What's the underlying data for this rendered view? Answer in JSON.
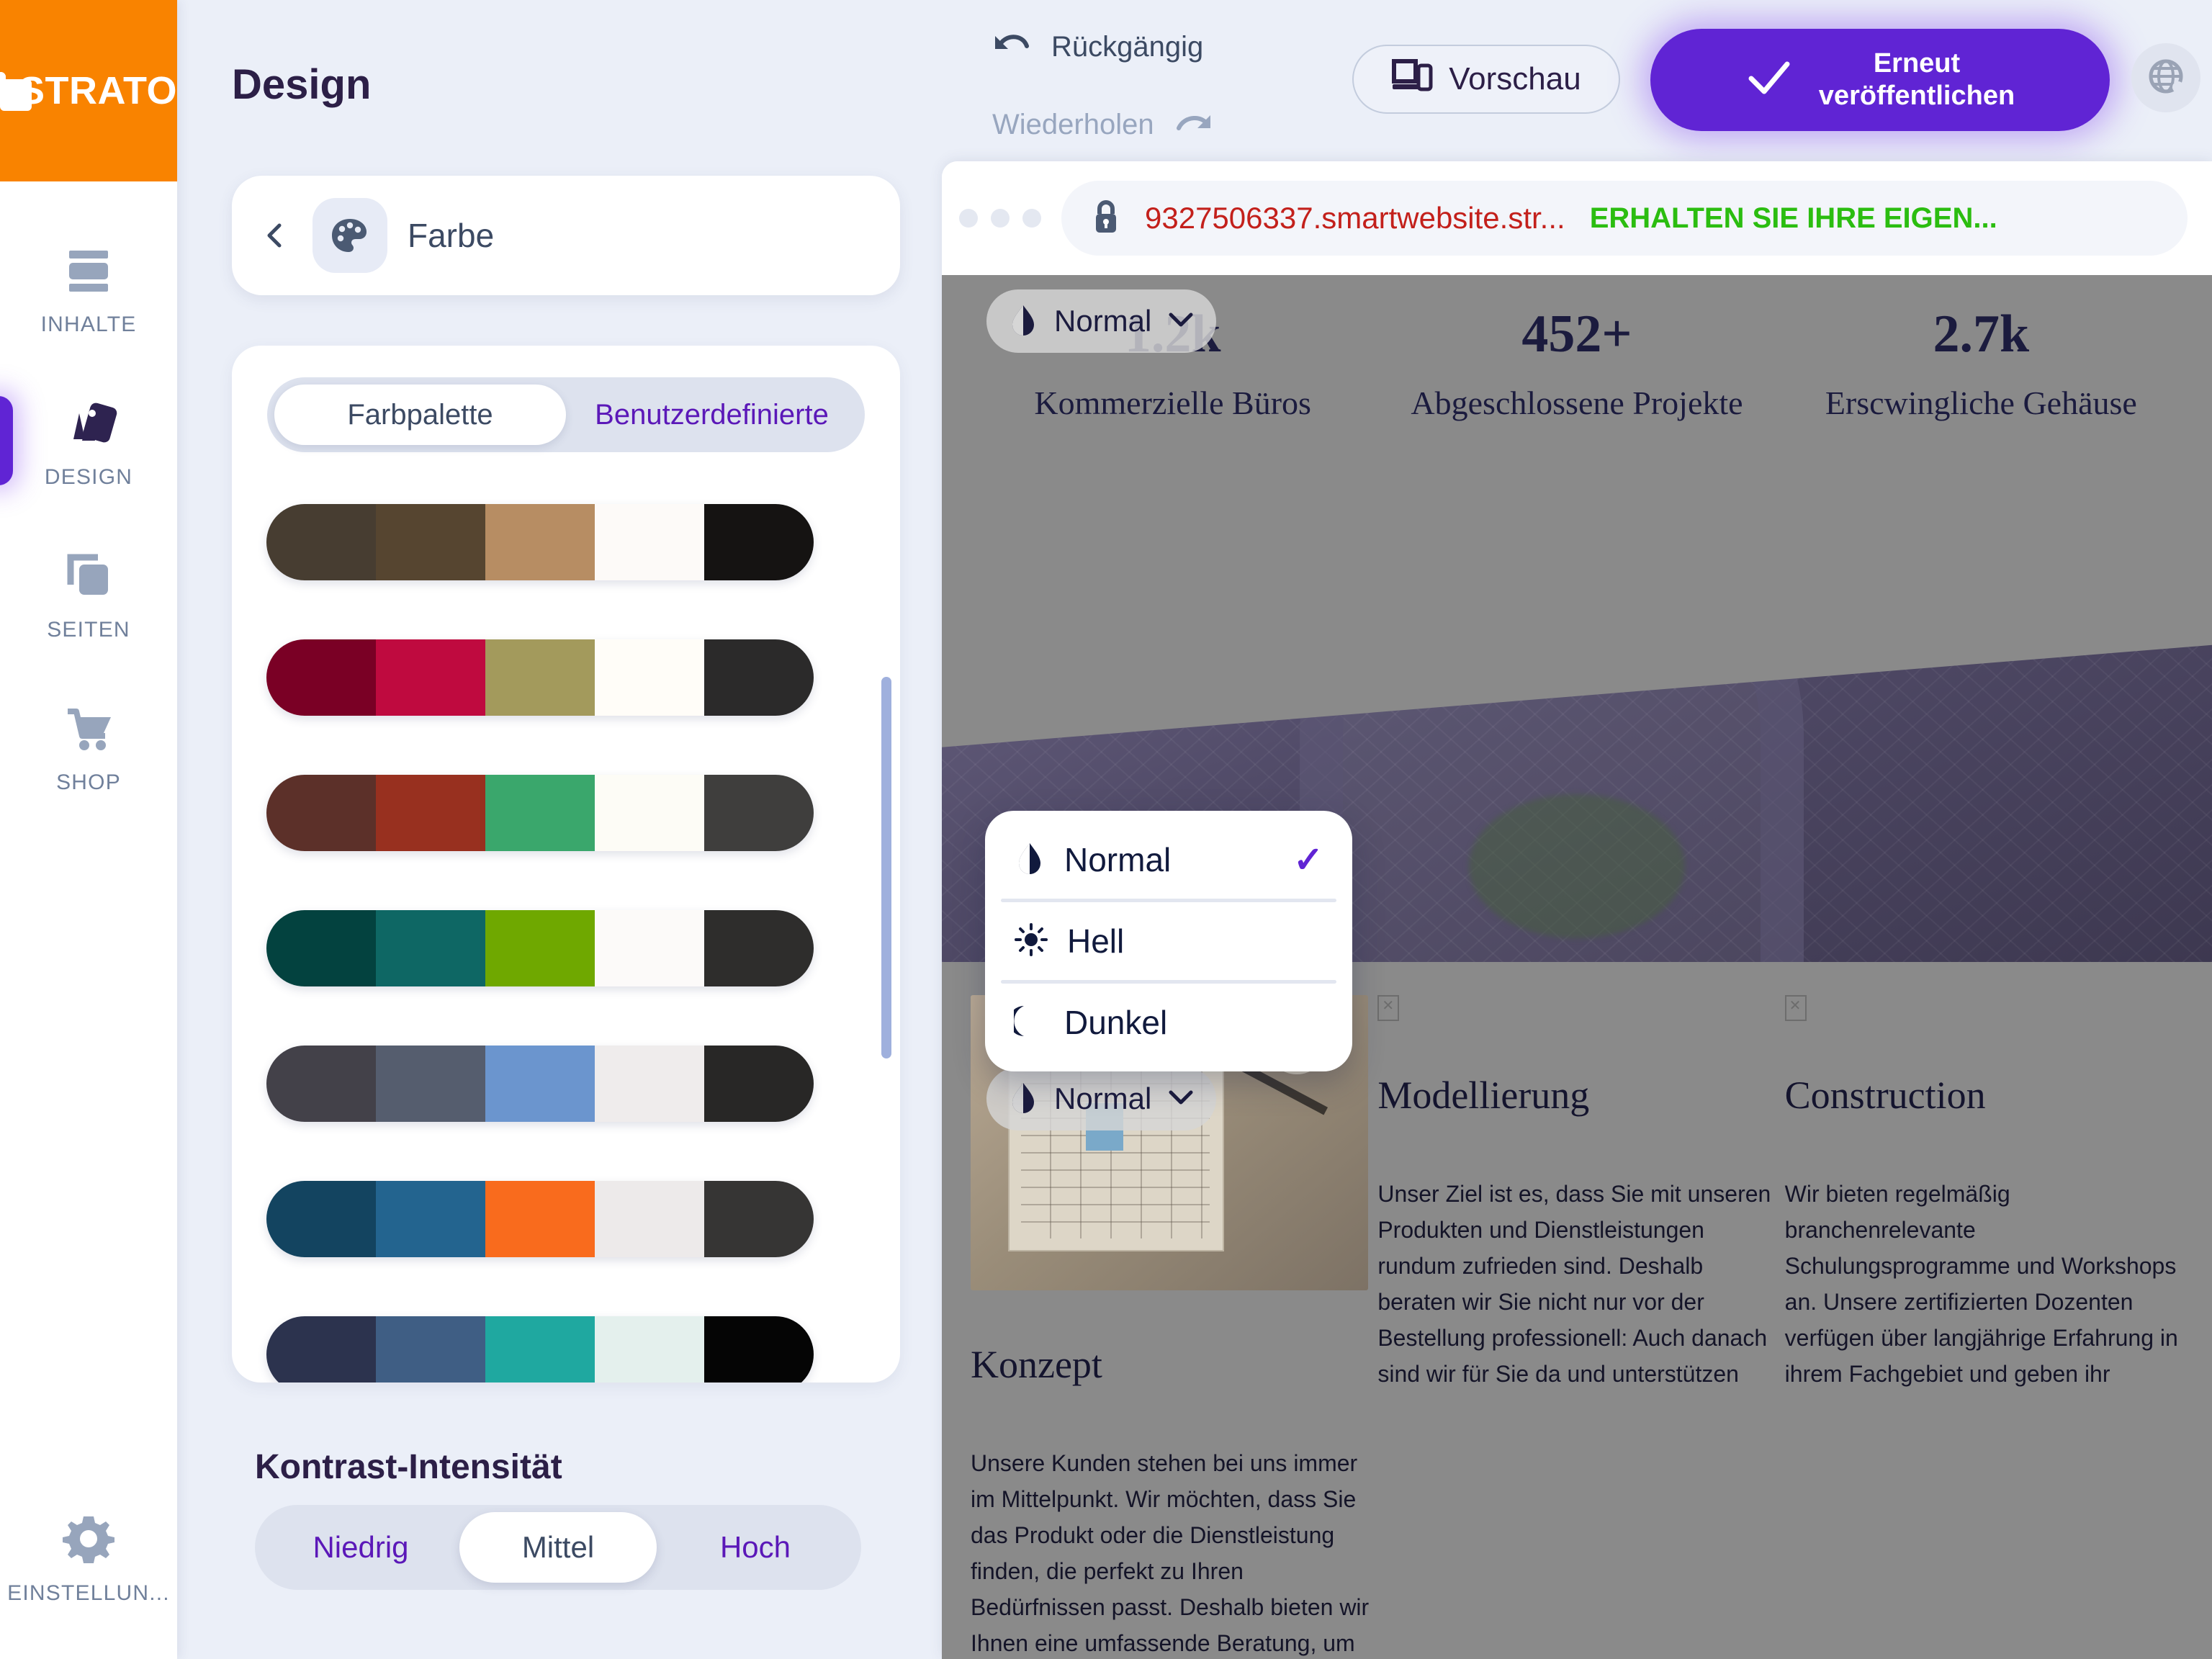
{
  "brand": {
    "name": "STRATO"
  },
  "rail": {
    "items": [
      {
        "label": "INHALTE",
        "icon": "content-layout-icon",
        "active": false
      },
      {
        "label": "DESIGN",
        "icon": "design-swatches-icon",
        "active": true
      },
      {
        "label": "SEITEN",
        "icon": "pages-icon",
        "active": false
      },
      {
        "label": "SHOP",
        "icon": "cart-icon",
        "active": false
      }
    ],
    "bottom": {
      "label": "EINSTELLUN...",
      "icon": "gear-icon"
    }
  },
  "panel": {
    "title": "Design",
    "farbe": {
      "label": "Farbe",
      "back_icon": "chevron-left-icon",
      "icon": "palette-icon"
    },
    "tabs": [
      {
        "label": "Farbpalette",
        "active": true
      },
      {
        "label": "Benutzerdefinierte",
        "active": false
      }
    ],
    "palettes": [
      {
        "colors": [
          "#473D31",
          "#564530",
          "#B78D63",
          "#FDFAF8",
          "#151312"
        ]
      },
      {
        "colors": [
          "#7A0025",
          "#BF0A3F",
          "#A39A5C",
          "#FFFDF8",
          "#2B2A2A"
        ]
      },
      {
        "colors": [
          "#5C3029",
          "#98301F",
          "#3AA76C",
          "#FDFCF6",
          "#3F3E3D"
        ]
      },
      {
        "colors": [
          "#03423F",
          "#0E6764",
          "#6FA800",
          "#FCFAF9",
          "#2E2D2C"
        ]
      },
      {
        "colors": [
          "#434149",
          "#555D6E",
          "#6B95CE",
          "#EFECEC",
          "#282726"
        ]
      },
      {
        "colors": [
          "#134460",
          "#23648F",
          "#F96B1D",
          "#EDEAEA",
          "#363534"
        ]
      },
      {
        "colors": [
          "#2C334E",
          "#3F5E84",
          "#1FA8A0",
          "#E4F0ED",
          "#050505"
        ]
      }
    ],
    "kontrast": {
      "title": "Kontrast-Intensität",
      "options": [
        {
          "label": "Niedrig",
          "active": false
        },
        {
          "label": "Mittel",
          "active": true
        },
        {
          "label": "Hoch",
          "active": false
        }
      ]
    }
  },
  "toolbar": {
    "undo": {
      "label": "Rückgängig",
      "icon": "undo-arrow-icon",
      "enabled": true
    },
    "redo": {
      "label": "Wiederholen",
      "icon": "redo-arrow-icon",
      "enabled": false
    },
    "preview": {
      "label": "Vorschau",
      "icon": "devices-icon"
    },
    "publish": {
      "line1": "Erneut",
      "line2": "veröffentlichen",
      "icon": "check-icon",
      "color": "#6024D4"
    },
    "language": {
      "icon": "globe-icon"
    }
  },
  "preview": {
    "addressbar": {
      "lock_icon": "lock-icon",
      "url": "9327506337.smartwebsite.str...",
      "url_color": "#C3201B",
      "promo": "ERHALTEN SIE IHRE EIGEN...",
      "promo_color": "#2BBD10"
    },
    "blend_chip_top": {
      "label": "Normal",
      "icon": "contrast-icon",
      "caret": "chevron-down-icon"
    },
    "blend_chip_mid": {
      "label": "Normal",
      "icon": "contrast-icon",
      "caret": "chevron-down-icon"
    },
    "stats": [
      {
        "value": "1.2k",
        "label": "Kommerzielle Büros"
      },
      {
        "value": "452+",
        "label": "Abgeschlossene Projekte"
      },
      {
        "value": "2.7k",
        "label": "Erscwingliche Gehäuse"
      }
    ],
    "columns": [
      {
        "title": "Konzept",
        "body": "Unsere Kunden stehen bei uns immer im Mittelpunkt. Wir möchten, dass Sie das Produkt oder die Dienstleistung finden, die perfekt zu Ihren Bedürfnissen passt. Deshalb bieten wir Ihnen eine umfassende Beratung, um"
      },
      {
        "title": "Modellierung",
        "body": "Unser Ziel ist es, dass Sie mit unseren Produkten und Dienstleistungen rundum zufrieden sind. Deshalb beraten wir Sie nicht nur vor der Bestellung professionell: Auch danach sind wir für Sie da und unterstützen"
      },
      {
        "title": "Construction",
        "body": "Wir bieten regelmäßig branchenrelevante Schulungsprogramme und Workshops an. Unsere zertifizierten Dozenten verfügen über langjährige Erfahrung in ihrem Fachgebiet und geben ihr"
      }
    ]
  },
  "menu": {
    "items": [
      {
        "label": "Normal",
        "icon": "contrast-icon",
        "checked": true
      },
      {
        "label": "Hell",
        "icon": "sun-icon",
        "checked": false
      },
      {
        "label": "Dunkel",
        "icon": "moon-icon",
        "checked": false
      }
    ],
    "check_glyph": "✓"
  }
}
